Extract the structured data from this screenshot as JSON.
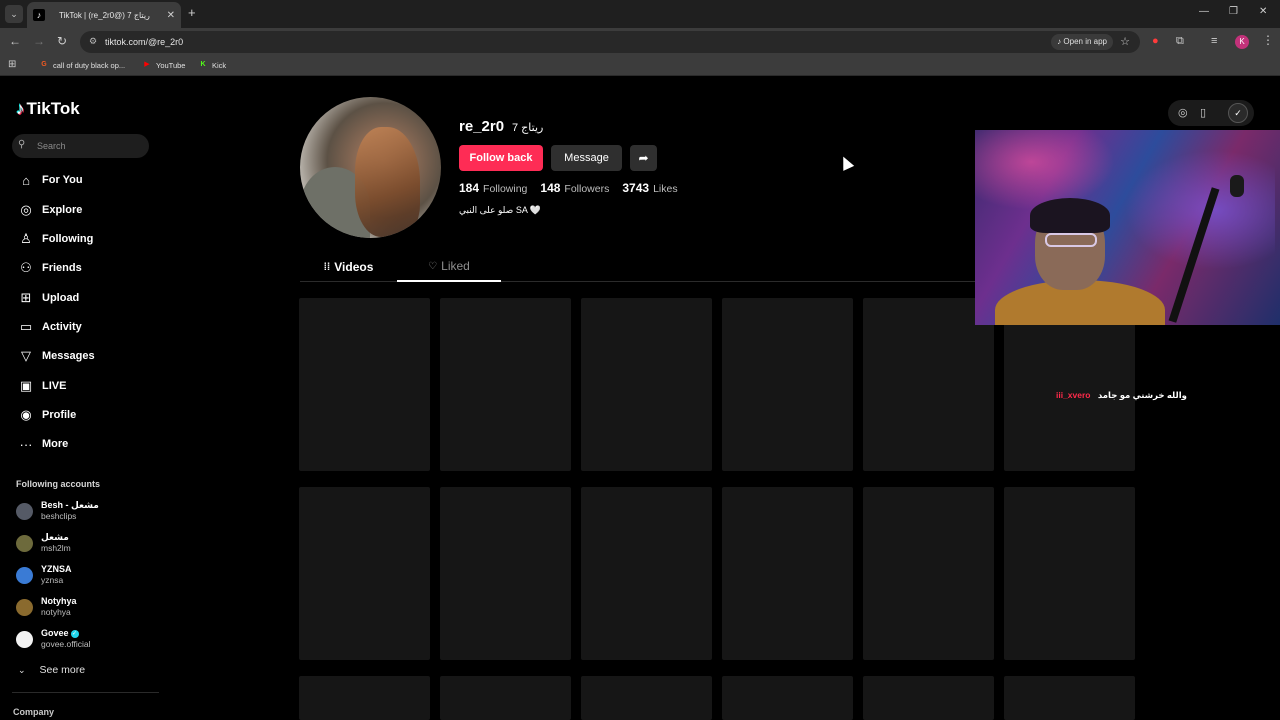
{
  "browser": {
    "tab_title": "TikTok | (re_2r0@) ريتاج 7",
    "new_tab_symbol": "+",
    "url": "tiktok.com/@re_2r0",
    "open_in_app": "Open in app",
    "bookmarks": [
      {
        "label": "call of duty black op...",
        "color": "#f05a22",
        "glyph": "G"
      },
      {
        "label": "YouTube",
        "color": "#ff0000",
        "glyph": "▶"
      },
      {
        "label": "Kick",
        "color": "#53fc18",
        "glyph": "K"
      }
    ],
    "profile_initial": "K"
  },
  "sidebar": {
    "logo": "TikTok",
    "search_placeholder": "Search",
    "nav": [
      {
        "label": "For You",
        "icon": "home-icon"
      },
      {
        "label": "Explore",
        "icon": "compass-icon"
      },
      {
        "label": "Following",
        "icon": "following-icon"
      },
      {
        "label": "Friends",
        "icon": "friends-icon"
      },
      {
        "label": "Upload",
        "icon": "upload-icon"
      },
      {
        "label": "Activity",
        "icon": "activity-icon"
      },
      {
        "label": "Messages",
        "icon": "messages-icon"
      },
      {
        "label": "LIVE",
        "icon": "live-icon"
      },
      {
        "label": "Profile",
        "icon": "profile-icon"
      },
      {
        "label": "More",
        "icon": "more-icon"
      }
    ],
    "following_title": "Following accounts",
    "following_accounts": [
      {
        "name": "Besh - مشعل",
        "username": "beshclips",
        "verified": false,
        "color": "#555a66"
      },
      {
        "name": "مشعل",
        "username": "msh2lm",
        "verified": false,
        "color": "#6d6a3c"
      },
      {
        "name": "YZNSA",
        "username": "yznsa",
        "verified": false,
        "color": "#3a7bd5"
      },
      {
        "name": "Notyhya",
        "username": "notyhya",
        "verified": false,
        "color": "#8a6a2e"
      },
      {
        "name": "Govee",
        "username": "govee.official",
        "verified": true,
        "color": "#f2f2f2"
      }
    ],
    "see_more": "See more",
    "company": "Company"
  },
  "profile": {
    "username": "re_2r0",
    "nickname": "ريتاج 7",
    "follow_button": "Follow back",
    "message_button": "Message",
    "following_count": "184",
    "following_label": "Following",
    "followers_count": "148",
    "followers_label": "Followers",
    "likes_count": "3743",
    "likes_label": "Likes",
    "bio": "صلو على النبي SA 🤍",
    "tabs": {
      "videos": "Videos",
      "liked": "Liked"
    },
    "active_tab": "liked"
  },
  "stream_overlay": {
    "chat_user": "iii_xvero",
    "chat_message": "والله خرشني مو جامد"
  },
  "colors": {
    "accent": "#fe2c55",
    "background": "#000000",
    "chrome": "#3c3c3c"
  }
}
